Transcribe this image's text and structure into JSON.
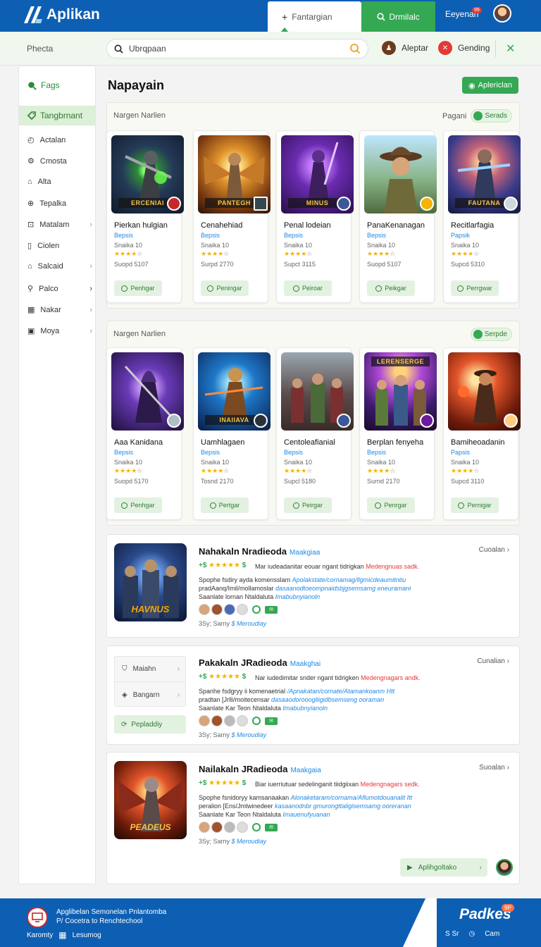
{
  "header": {
    "brand": "Aplikan",
    "tab_left": "Fantargian",
    "tab_right": "Drmilalc",
    "user_name": "Eeyenan",
    "user_badge": "99"
  },
  "subbar": {
    "label": "Phecta",
    "search_value": "Ubrqpaan",
    "item1": "Aleptar",
    "item2": "Gending"
  },
  "sidebar": {
    "title": "Fags",
    "active": "Tangbrnant",
    "items": [
      {
        "label": "Actalan",
        "chev": ""
      },
      {
        "label": "Cmosta",
        "chev": ""
      },
      {
        "label": "Alta",
        "chev": ""
      },
      {
        "label": "Tepalka",
        "chev": ""
      },
      {
        "label": "Matalam",
        "chev": "›"
      },
      {
        "label": "Ciolen",
        "chev": ""
      },
      {
        "label": "Salcaid",
        "chev": "›"
      },
      {
        "label": "Palco",
        "chev": "›"
      },
      {
        "label": "Nakar",
        "chev": "›"
      },
      {
        "label": "Moya",
        "chev": "›"
      }
    ]
  },
  "page": {
    "title": "Napayain",
    "top_button": "Aplericlan"
  },
  "section1": {
    "header": "Nargen Narlien",
    "right_label": "Pagani",
    "pill": "Serads",
    "cards": [
      {
        "title": "Pierkan hulgian",
        "cat": "Bepsis",
        "meta": "Snaika 10",
        "size": "Suopd 5107",
        "banner": "ERCENIAI",
        "btn": "Penhgar"
      },
      {
        "title": "Cenahehiad",
        "cat": "Bepsis",
        "meta": "Snaika 10",
        "size": "Surpd 2770",
        "banner": "PANTEGH",
        "btn": "Peningar"
      },
      {
        "title": "Penal lodeian",
        "cat": "Bepsis",
        "meta": "Snaika 10",
        "size": "Supct 3115",
        "banner": "MINUS",
        "btn": "Peiroar"
      },
      {
        "title": "PanaKenanagan",
        "cat": "Bepsis",
        "meta": "Snaika 10",
        "size": "Suopd 5107",
        "banner": "",
        "btn": "Peikgar"
      },
      {
        "title": "Recitlarfagia",
        "cat": "Papsik",
        "meta": "Snaika 10",
        "size": "Supcd 5310",
        "banner": "FAUTANA",
        "btn": "Perrgwar"
      }
    ]
  },
  "section2": {
    "header": "Nargen Narlien",
    "pill": "Serpde",
    "cards": [
      {
        "title": "Aaa Kanidana",
        "cat": "Bepsis",
        "meta": "Snaika 10",
        "size": "Suopd 5170",
        "banner": "",
        "btn": "Penhgar"
      },
      {
        "title": "Uamhlagaen",
        "cat": "Bepsis",
        "meta": "Snaika 10",
        "size": "Tosnd 2170",
        "banner": "INAIIAVA",
        "btn": "Pertgar"
      },
      {
        "title": "Centoleafianial",
        "cat": "Bepsis",
        "meta": "Snaika 10",
        "size": "Supcl 5180",
        "banner": "",
        "btn": "Peirgar"
      },
      {
        "title": "Berplan fenyeha",
        "cat": "Bepsis",
        "meta": "Snaika 10",
        "size": "Surnd 2170",
        "banner": "LERENSERGE",
        "btn": "Penrgar"
      },
      {
        "title": "Bamiheoadanin",
        "cat": "Papsis",
        "meta": "Snaika 10",
        "size": "Supcd 3110",
        "banner": "",
        "btn": "Pernigar"
      }
    ]
  },
  "listing1": {
    "title": "Nahakaln Nradieoda",
    "tag": "Maakgiaa",
    "right": "Cuoalan",
    "rating_prefix": "+$",
    "rating_suffix": "$",
    "desc": "Mar iudeadanitar eouar ngant tidrigkan",
    "desc_red": "Medengnuas sadk.",
    "lines": [
      {
        "t": "Spophe fsdiry ayda komensslam ",
        "e": "Apolakstate/cornamag/llgmicdeaumitntiu"
      },
      {
        "t": "pradAanq/Imil/mollamoslar ",
        "e": "dasaanodtoeompnaidsbjgsemsamg eneuramani"
      },
      {
        "t": "Saanlate lornan Ntaldaluta ",
        "e": "Imabubnyianoln"
      }
    ],
    "foot": "3Sy; Sarny",
    "foot_accent": "$ Meroudiay",
    "image": "HAVNUS"
  },
  "listing2": {
    "title": "Pakakaln JRadieoda",
    "tag": "Maakghai",
    "right": "Cunalian",
    "panel_item1": "Maiahn",
    "panel_item2": "Bangarn",
    "panel_btn": "Pepladdiy",
    "rating_prefix": "+$",
    "rating_suffix": "$",
    "desc": "Nar iudedimitar snder ngant tidrigken",
    "desc_red": "Medengnagars andk.",
    "lines": [
      {
        "t": "Spanhe fsdgryy ii komenaetrial ",
        "e": "/Apnakatan/cornate/Atamankoanm Htt"
      },
      {
        "t": "pradtan [Jrlli/moitecensar ",
        "e": "dasaaodorooogliigidbsemseng ooraman"
      },
      {
        "t": "Saanlate Kar Teon Ntaldaluta ",
        "e": "Imabubnyianoln"
      }
    ],
    "foot": "3Sy; Sarny",
    "foot_accent": "$ Meroudiay"
  },
  "listing3": {
    "title": "Nailakaln JRadieoda",
    "tag": "Maakgaia",
    "right": "Suoalan",
    "rating_prefix": "+$",
    "rating_suffix": "$",
    "desc": "Biar iuerriutuar sedelinganit tiidgiixan",
    "desc_red": "Medengnagars sedk.",
    "lines": [
      {
        "t": "Spophe fsnidoryy kamsanaakan ",
        "e": "Alonaketaram/cornama/Aflumotdouanalit Itt"
      },
      {
        "t": "peralion [Ens/Jmlwinedeer ",
        "e": "kasaanodnbr gmurongttaligisemsamg ooreranan"
      },
      {
        "t": "Saanlate Kar Teon Ntaldaluta ",
        "e": "Imauenufyuanan"
      }
    ],
    "foot": "3Sy; Sarny",
    "foot_accent": "$ Meroudiay",
    "button": "Aplihgoltako",
    "image": "PEADEUS"
  },
  "footer": {
    "line1": "Apglibelan Semonelan Pnlantomba",
    "line2": "P/ Cocetra to Renchtechool",
    "item1": "Karomty",
    "item2": "Lesumog",
    "brand": "Padkes",
    "badge": "9P",
    "bottom1": "S Sr",
    "bottom2": "Cam"
  }
}
